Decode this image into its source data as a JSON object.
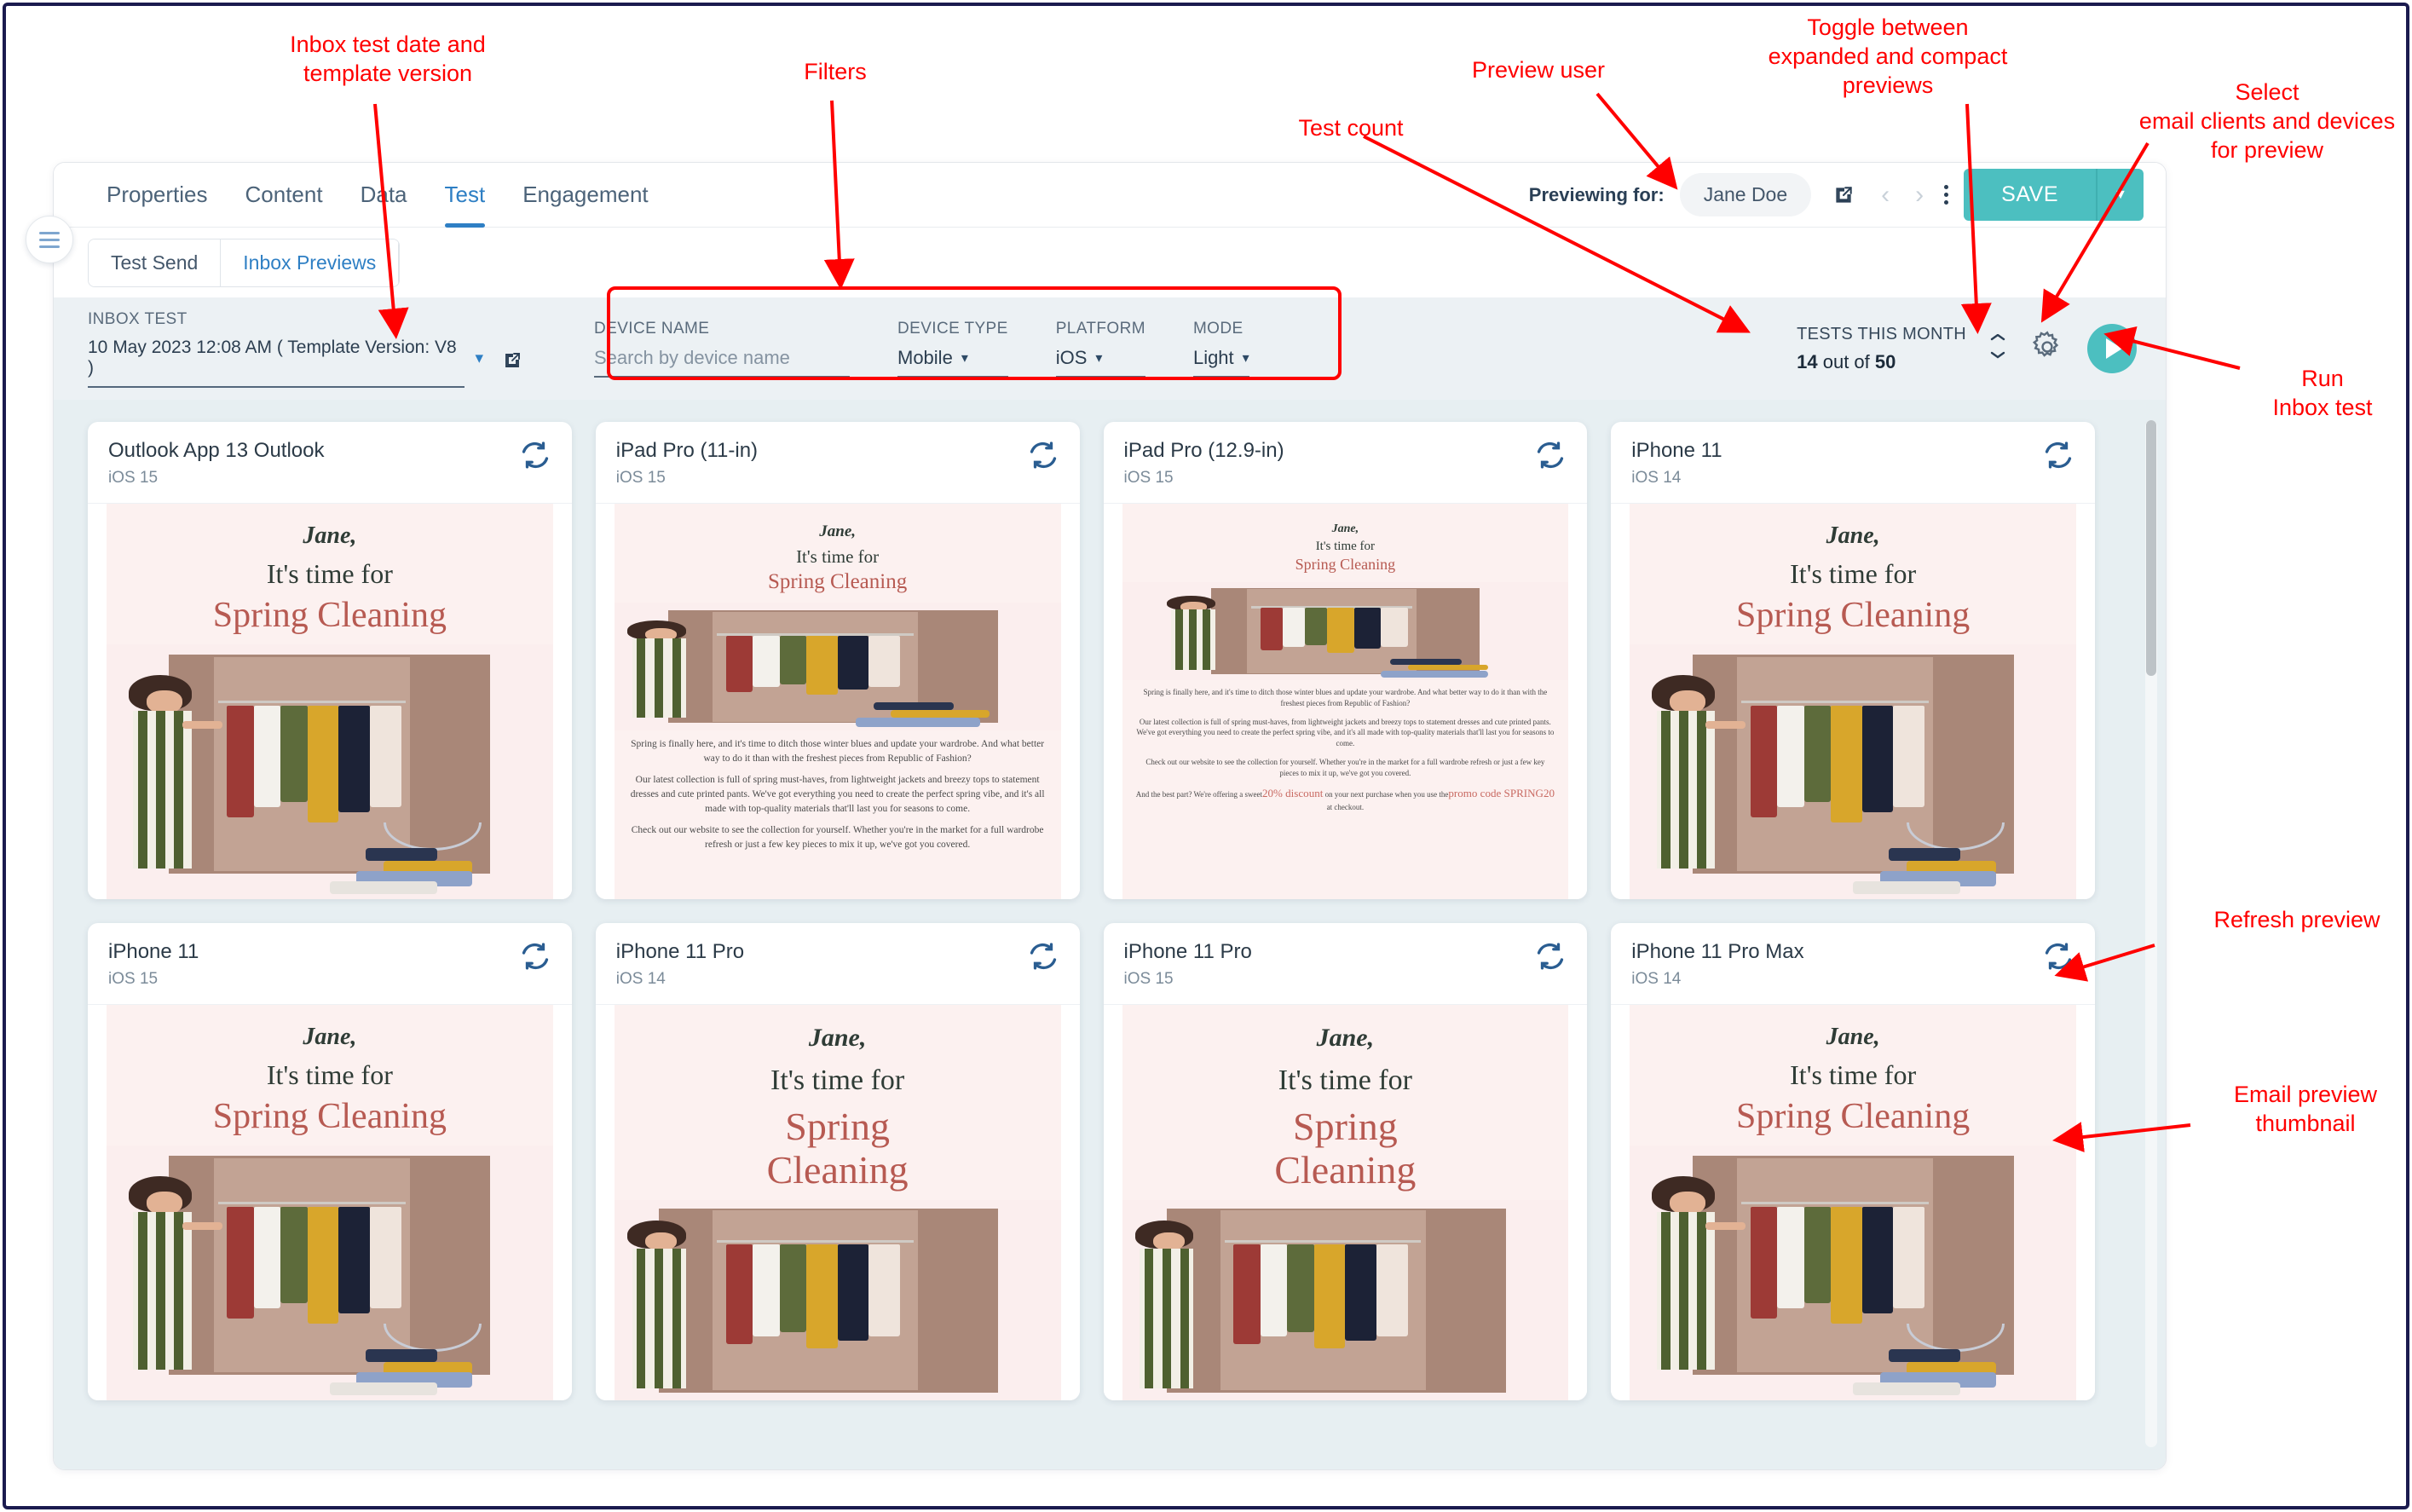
{
  "topbar": {
    "tabs": [
      {
        "label": "Properties",
        "active": false
      },
      {
        "label": "Content",
        "active": false
      },
      {
        "label": "Data",
        "active": false
      },
      {
        "label": "Test",
        "active": true
      },
      {
        "label": "Engagement",
        "active": false
      }
    ],
    "previewing_label": "Previewing for:",
    "preview_user": "Jane Doe",
    "save_label": "SAVE"
  },
  "subtabs": [
    {
      "label": "Test Send",
      "active": false
    },
    {
      "label": "Inbox Previews",
      "active": true
    }
  ],
  "filters": {
    "inbox_test_label": "INBOX TEST",
    "inbox_test_value": "10 May 2023 12:08 AM ( Template Version: V8 )",
    "device_name_label": "DEVICE NAME",
    "device_name_placeholder": "Search by device name",
    "device_name_value": "",
    "device_type_label": "DEVICE TYPE",
    "device_type_value": "Mobile",
    "platform_label": "PLATFORM",
    "platform_value": "iOS",
    "mode_label": "MODE",
    "mode_value": "Light"
  },
  "tests": {
    "title": "TESTS THIS MONTH",
    "used": "14",
    "out_of_label": "out of",
    "total": "50"
  },
  "email": {
    "greeting": "Jane,",
    "line2": "It's time for",
    "line3": "Spring Cleaning",
    "line3_a": "Spring",
    "line3_b": "Cleaning",
    "para1": "Spring is finally here, and it's time to ditch those winter blues and update your wardrobe. And what better way to do it than with the freshest pieces from Republic of Fashion?",
    "para2": "Our latest collection is full of spring must-haves, from lightweight jackets and breezy tops to statement dresses and cute printed pants. We've got everything you need to create the perfect spring vibe, and it's all made with top-quality materials that'll last you for seasons to come.",
    "para3": "Check out our website to see the collection for yourself. Whether you're in the market for a full wardrobe refresh or just a few key pieces to mix it up, we've got you covered.",
    "para4_pre": "And the best part? We're offering a sweet",
    "para4_discount": "20% discount",
    "para4_mid": " on your next purchase when you use the",
    "para4_promo": "promo code SPRING20",
    "para4_post": " at checkout."
  },
  "cards": [
    {
      "device": "Outlook App 13 Outlook",
      "os": "iOS 15",
      "size": "lg",
      "body": "none"
    },
    {
      "device": "iPad Pro (11-in)",
      "os": "iOS 15",
      "size": "md",
      "body": "full"
    },
    {
      "device": "iPad Pro (12.9-in)",
      "os": "iOS 15",
      "size": "sm",
      "body": "full"
    },
    {
      "device": "iPhone 11",
      "os": "iOS 14",
      "size": "lg",
      "body": "none"
    },
    {
      "device": "iPhone 11",
      "os": "iOS 15",
      "size": "lg",
      "body": "none"
    },
    {
      "device": "iPhone 11 Pro",
      "os": "iOS 14",
      "size": "xl",
      "body": "none"
    },
    {
      "device": "iPhone 11 Pro",
      "os": "iOS 15",
      "size": "xl",
      "body": "none"
    },
    {
      "device": "iPhone 11 Pro Max",
      "os": "iOS 14",
      "size": "lg",
      "body": "none"
    }
  ],
  "annotations": [
    {
      "id": "a1",
      "text": "Inbox test date and\ntemplate version"
    },
    {
      "id": "a2",
      "text": "Filters"
    },
    {
      "id": "a3",
      "text": "Test count"
    },
    {
      "id": "a4",
      "text": "Preview user"
    },
    {
      "id": "a5",
      "text": "Toggle between\nexpanded and compact\npreviews"
    },
    {
      "id": "a6",
      "text": "Select\nemail clients and devices\nfor preview"
    },
    {
      "id": "a7",
      "text": "Run\nInbox test"
    },
    {
      "id": "a8",
      "text": "Refresh preview"
    },
    {
      "id": "a9",
      "text": "Email preview\nthumbnail"
    }
  ],
  "colors": {
    "accent_teal": "#4cbfc0",
    "accent_blue": "#2e7fc4",
    "annotation_red": "#ff0000",
    "content_bg": "#e7eff2",
    "filter_bg": "#ecf1f4",
    "email_bg": "#fcf1f0",
    "email_heading": "#b75a52"
  }
}
